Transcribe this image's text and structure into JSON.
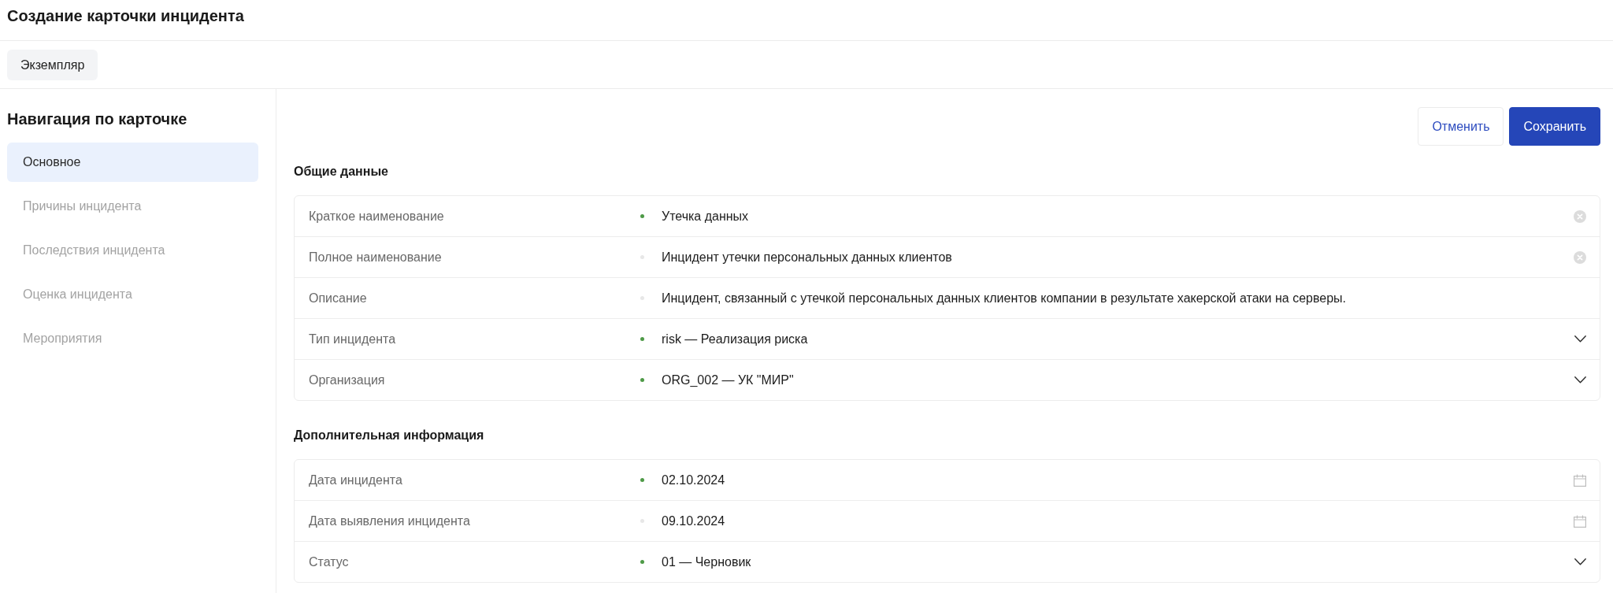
{
  "page": {
    "title": "Создание карточки инцидента"
  },
  "tabs": [
    {
      "label": "Экземпляр",
      "selected": true
    }
  ],
  "sidebar": {
    "title": "Навигация по карточке",
    "items": [
      {
        "label": "Основное",
        "selected": true
      },
      {
        "label": "Причины инцидента",
        "selected": false
      },
      {
        "label": "Последствия инцидента",
        "selected": false
      },
      {
        "label": "Оценка инцидента",
        "selected": false
      },
      {
        "label": "Мероприятия",
        "selected": false
      }
    ]
  },
  "actions": [
    {
      "label": "Отменить",
      "kind": "secondary"
    },
    {
      "label": "Сохранить",
      "kind": "primary"
    }
  ],
  "sections": [
    {
      "title": "Общие данные",
      "fields": [
        {
          "label": "Краткое наименование",
          "required": true,
          "value": "Утечка данных",
          "kind": "text"
        },
        {
          "label": "Полное наименование",
          "required": false,
          "value": "Инцидент утечки персональных данных клиентов",
          "kind": "text"
        },
        {
          "label": "Описание",
          "required": false,
          "value": "Инцидент, связанный с утечкой персональных данных клиентов компании в результате хакерской атаки на серверы.",
          "kind": "textarea"
        },
        {
          "label": "Тип инцидента",
          "required": true,
          "value": "risk — Реализация риска",
          "kind": "select"
        },
        {
          "label": "Организация",
          "required": true,
          "value": "ORG_002 — УК \"МИР\"",
          "kind": "select"
        }
      ]
    },
    {
      "title": "Дополнительная информация",
      "fields": [
        {
          "label": "Дата инцидента",
          "required": true,
          "value": "02.10.2024",
          "kind": "date"
        },
        {
          "label": "Дата выявления инцидента",
          "required": false,
          "value": "09.10.2024",
          "kind": "date"
        },
        {
          "label": "Статус",
          "required": true,
          "value": "01 — Черновик",
          "kind": "select"
        }
      ]
    }
  ]
}
